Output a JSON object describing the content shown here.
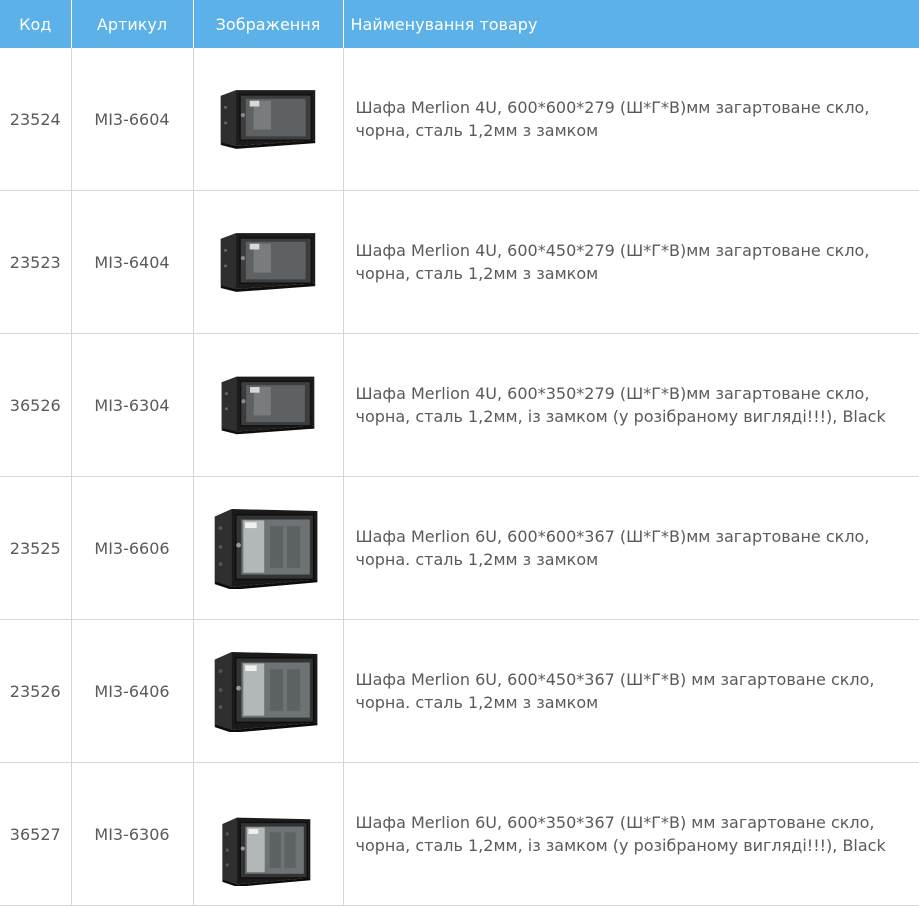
{
  "table": {
    "headers": {
      "code": "Код",
      "article": "Артикул",
      "image": "Зображення",
      "name": "Найменування товару"
    },
    "rows": [
      {
        "code": "23524",
        "article": "МІ3-6604",
        "image": "cabinet-4u-photo",
        "name": "Шафа Merlion 4U, 600*600*279 (Ш*Г*В)мм загартоване скло, чорна, сталь 1,2мм з замком"
      },
      {
        "code": "23523",
        "article": "МІ3-6404",
        "image": "cabinet-4u-photo",
        "name": "Шафа Merlion 4U, 600*450*279 (Ш*Г*В)мм загартоване скло, чорна, сталь 1,2мм з замком"
      },
      {
        "code": "36526",
        "article": "МІ3-6304",
        "image": "cabinet-4u-photo",
        "name": "Шафа Merlion 4U, 600*350*279 (Ш*Г*В)мм загартоване скло, чорна, сталь 1,2мм, із замком (у розібраному вигляді!!!), Black"
      },
      {
        "code": "23525",
        "article": "МІ3-6606",
        "image": "cabinet-6u-photo",
        "name": "Шафа Merlion 6U, 600*600*367 (Ш*Г*В)мм загартоване скло, чорна. сталь 1,2мм з замком"
      },
      {
        "code": "23526",
        "article": "МІ3-6406",
        "image": "cabinet-6u-photo",
        "name": "Шафа Merlion 6U, 600*450*367 (Ш*Г*В) мм загартоване скло, чорна. сталь 1,2мм з замком"
      },
      {
        "code": "36527",
        "article": "МІ3-6306",
        "image": "cabinet-6u-photo",
        "name": "Шафа Merlion 6U, 600*350*367 (Ш*Г*В) мм загартоване скло, чорна, сталь 1,2мм, із замком (у розібраному вигляді!!!), Black"
      }
    ]
  }
}
